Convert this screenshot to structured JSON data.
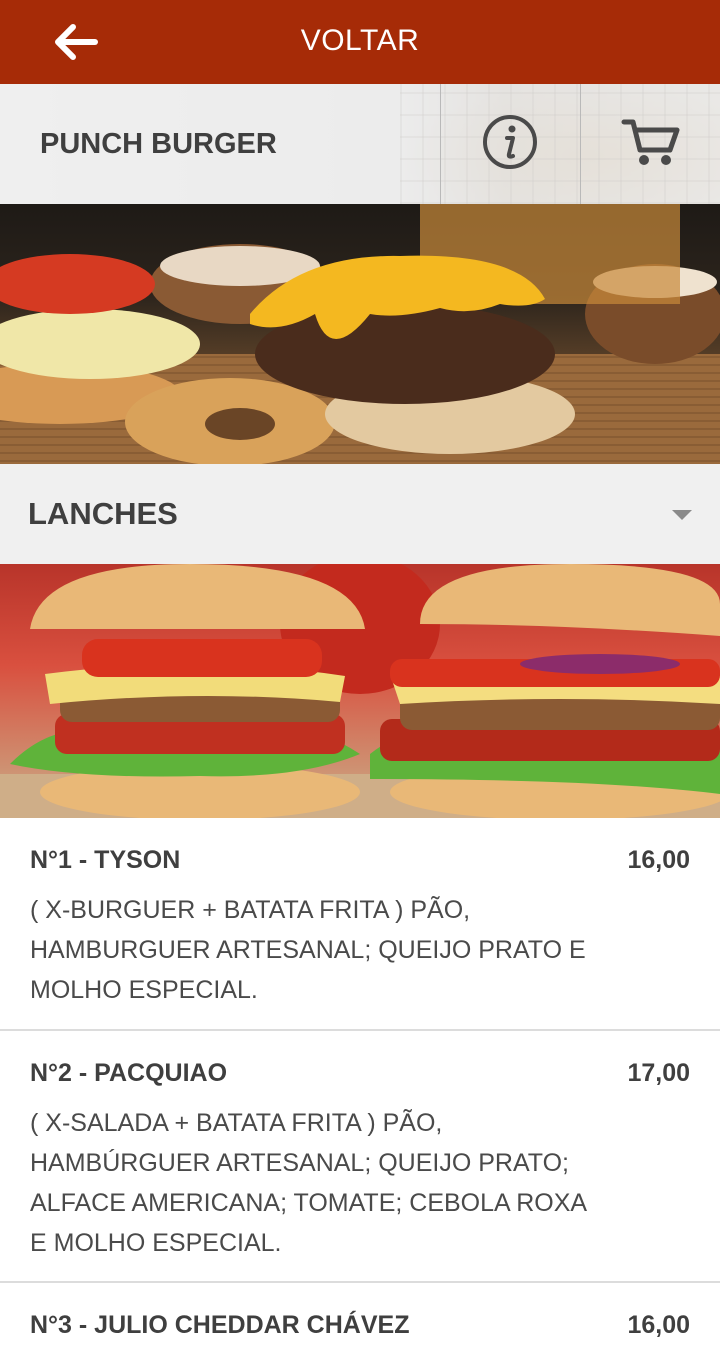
{
  "topbar": {
    "title": "VOLTAR",
    "back_icon": "arrow-left-icon",
    "color": "#a62b07"
  },
  "restaurant": {
    "name": "PUNCH BURGER",
    "info_icon": "info-icon",
    "cart_icon": "cart-icon"
  },
  "category": {
    "selected": "LANCHES",
    "dropdown_icon": "caret-down-icon"
  },
  "items": [
    {
      "name": "N°1 - TYSON",
      "price": "16,00",
      "description": "( X-BURGUER + BATATA FRITA ) PÃO, HAMBURGUER ARTESANAL; QUEIJO PRATO E MOLHO ESPECIAL."
    },
    {
      "name": "N°2 - PACQUIAO",
      "price": "17,00",
      "description": "( X-SALADA + BATATA FRITA ) PÃO, HAMBÚRGUER ARTESANAL; QUEIJO PRATO; ALFACE AMERICANA; TOMATE; CEBOLA ROXA E MOLHO ESPECIAL."
    },
    {
      "name": "N°3 - JULIO CHEDDAR CHÁVEZ",
      "price": "16,00",
      "description": ""
    }
  ]
}
